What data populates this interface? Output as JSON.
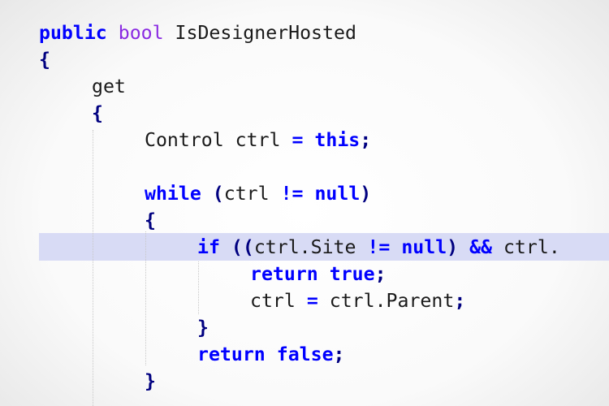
{
  "editor": {
    "highlighted_line": 8,
    "colors": {
      "keyword": "#0000ff",
      "type": "#8a2be2",
      "identifier": "#1a1a1a",
      "punctuation": "#000080",
      "highlight": "#d8dbf5"
    },
    "lines": [
      {
        "indent": 0,
        "tokens": [
          {
            "t": "public",
            "k": "kw"
          },
          {
            "t": " ",
            "k": "id"
          },
          {
            "t": "bool",
            "k": "type"
          },
          {
            "t": " IsDesignerHosted",
            "k": "id"
          }
        ]
      },
      {
        "indent": 0,
        "tokens": [
          {
            "t": "{",
            "k": "punct"
          }
        ]
      },
      {
        "indent": 1,
        "tokens": [
          {
            "t": "get",
            "k": "id"
          }
        ]
      },
      {
        "indent": 1,
        "tokens": [
          {
            "t": "{",
            "k": "punct"
          }
        ]
      },
      {
        "indent": 2,
        "tokens": [
          {
            "t": "Control ctrl ",
            "k": "id"
          },
          {
            "t": "=",
            "k": "op"
          },
          {
            "t": " ",
            "k": "id"
          },
          {
            "t": "this",
            "k": "kw"
          },
          {
            "t": ";",
            "k": "punct"
          }
        ]
      },
      {
        "indent": 2,
        "tokens": []
      },
      {
        "indent": 2,
        "tokens": [
          {
            "t": "while",
            "k": "kw"
          },
          {
            "t": " ",
            "k": "id"
          },
          {
            "t": "(",
            "k": "punct"
          },
          {
            "t": "ctrl ",
            "k": "id"
          },
          {
            "t": "!=",
            "k": "op"
          },
          {
            "t": " ",
            "k": "id"
          },
          {
            "t": "null",
            "k": "kw"
          },
          {
            "t": ")",
            "k": "punct"
          }
        ]
      },
      {
        "indent": 2,
        "tokens": [
          {
            "t": "{",
            "k": "punct"
          }
        ]
      },
      {
        "indent": 3,
        "tokens": [
          {
            "t": "if",
            "k": "kw"
          },
          {
            "t": " ",
            "k": "id"
          },
          {
            "t": "((",
            "k": "punct"
          },
          {
            "t": "ctrl.Site ",
            "k": "id"
          },
          {
            "t": "!=",
            "k": "op"
          },
          {
            "t": " ",
            "k": "id"
          },
          {
            "t": "null",
            "k": "kw"
          },
          {
            "t": ")",
            "k": "punct"
          },
          {
            "t": " ",
            "k": "id"
          },
          {
            "t": "&&",
            "k": "op"
          },
          {
            "t": " ctrl.",
            "k": "id"
          }
        ]
      },
      {
        "indent": 4,
        "tokens": [
          {
            "t": "return",
            "k": "kw"
          },
          {
            "t": " ",
            "k": "id"
          },
          {
            "t": "true",
            "k": "kw"
          },
          {
            "t": ";",
            "k": "punct"
          }
        ]
      },
      {
        "indent": 4,
        "tokens": [
          {
            "t": "ctrl ",
            "k": "id"
          },
          {
            "t": "=",
            "k": "op"
          },
          {
            "t": " ctrl.Parent",
            "k": "id"
          },
          {
            "t": ";",
            "k": "punct"
          }
        ]
      },
      {
        "indent": 3,
        "tokens": [
          {
            "t": "}",
            "k": "punct"
          }
        ]
      },
      {
        "indent": 3,
        "tokens": [
          {
            "t": "return",
            "k": "kw"
          },
          {
            "t": " ",
            "k": "id"
          },
          {
            "t": "false",
            "k": "kw"
          },
          {
            "t": ";",
            "k": "punct"
          }
        ]
      },
      {
        "indent": 2,
        "tokens": [
          {
            "t": "}",
            "k": "punct"
          }
        ]
      }
    ]
  }
}
